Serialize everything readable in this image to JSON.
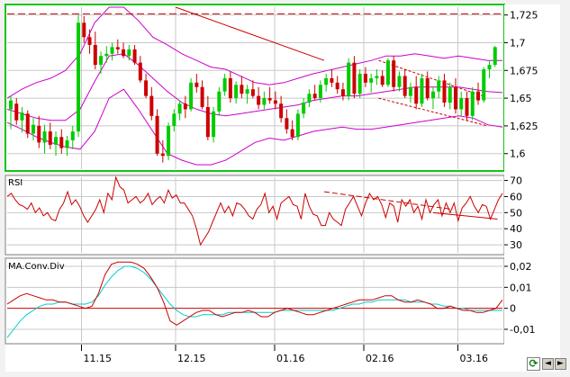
{
  "chart_data": [
    {
      "type": "candlestick",
      "panel": "price",
      "y_ticks": [
        "1,725",
        "1,7",
        "1,675",
        "1,65",
        "1,625",
        "1,6"
      ],
      "ylim": [
        1.586,
        1.732
      ],
      "x_ticks": [
        "11.15",
        "12.15",
        "01.16",
        "02.16",
        "03.16"
      ],
      "candles": [
        [
          1.64,
          1.652,
          1.622,
          1.648
        ],
        [
          1.645,
          1.65,
          1.626,
          1.63
        ],
        [
          1.63,
          1.642,
          1.619,
          1.637
        ],
        [
          1.636,
          1.639,
          1.614,
          1.618
        ],
        [
          1.618,
          1.632,
          1.612,
          1.626
        ],
        [
          1.625,
          1.634,
          1.605,
          1.61
        ],
        [
          1.61,
          1.626,
          1.6,
          1.62
        ],
        [
          1.62,
          1.628,
          1.604,
          1.608
        ],
        [
          1.608,
          1.62,
          1.598,
          1.615
        ],
        [
          1.615,
          1.622,
          1.6,
          1.605
        ],
        [
          1.605,
          1.616,
          1.598,
          1.612
        ],
        [
          1.612,
          1.625,
          1.604,
          1.62
        ],
        [
          1.62,
          1.725,
          1.615,
          1.718
        ],
        [
          1.718,
          1.724,
          1.7,
          1.705
        ],
        [
          1.705,
          1.712,
          1.69,
          1.698
        ],
        [
          1.698,
          1.71,
          1.676,
          1.68
        ],
        [
          1.68,
          1.692,
          1.672,
          1.688
        ],
        [
          1.688,
          1.697,
          1.682,
          1.69
        ],
        [
          1.69,
          1.7,
          1.684,
          1.696
        ],
        [
          1.696,
          1.703,
          1.69,
          1.694
        ],
        [
          1.694,
          1.7,
          1.686,
          1.688
        ],
        [
          1.688,
          1.698,
          1.684,
          1.694
        ],
        [
          1.694,
          1.698,
          1.68,
          1.682
        ],
        [
          1.682,
          1.688,
          1.664,
          1.666
        ],
        [
          1.666,
          1.672,
          1.65,
          1.652
        ],
        [
          1.652,
          1.66,
          1.63,
          1.634
        ],
        [
          1.634,
          1.64,
          1.598,
          1.6
        ],
        [
          1.6,
          1.612,
          1.592,
          1.598
        ],
        [
          1.598,
          1.628,
          1.594,
          1.625
        ],
        [
          1.625,
          1.64,
          1.62,
          1.636
        ],
        [
          1.636,
          1.648,
          1.63,
          1.645
        ],
        [
          1.645,
          1.652,
          1.632,
          1.64
        ],
        [
          1.64,
          1.668,
          1.638,
          1.664
        ],
        [
          1.664,
          1.672,
          1.655,
          1.66
        ],
        [
          1.66,
          1.666,
          1.64,
          1.642
        ],
        [
          1.642,
          1.652,
          1.612,
          1.615
        ],
        [
          1.615,
          1.642,
          1.61,
          1.638
        ],
        [
          1.638,
          1.66,
          1.634,
          1.656
        ],
        [
          1.656,
          1.672,
          1.652,
          1.668
        ],
        [
          1.668,
          1.674,
          1.646,
          1.65
        ],
        [
          1.65,
          1.665,
          1.645,
          1.662
        ],
        [
          1.662,
          1.67,
          1.65,
          1.654
        ],
        [
          1.654,
          1.662,
          1.645,
          1.658
        ],
        [
          1.658,
          1.666,
          1.65,
          1.652
        ],
        [
          1.652,
          1.66,
          1.64,
          1.644
        ],
        [
          1.644,
          1.656,
          1.64,
          1.65
        ],
        [
          1.65,
          1.66,
          1.645,
          1.648
        ],
        [
          1.648,
          1.656,
          1.64,
          1.645
        ],
        [
          1.645,
          1.652,
          1.628,
          1.632
        ],
        [
          1.632,
          1.64,
          1.618,
          1.622
        ],
        [
          1.622,
          1.63,
          1.612,
          1.615
        ],
        [
          1.615,
          1.64,
          1.612,
          1.636
        ],
        [
          1.636,
          1.65,
          1.632,
          1.646
        ],
        [
          1.646,
          1.658,
          1.642,
          1.654
        ],
        [
          1.654,
          1.662,
          1.648,
          1.65
        ],
        [
          1.65,
          1.666,
          1.646,
          1.662
        ],
        [
          1.662,
          1.672,
          1.656,
          1.668
        ],
        [
          1.668,
          1.676,
          1.66,
          1.664
        ],
        [
          1.664,
          1.67,
          1.654,
          1.658
        ],
        [
          1.658,
          1.664,
          1.648,
          1.652
        ],
        [
          1.652,
          1.686,
          1.648,
          1.682
        ],
        [
          1.682,
          1.688,
          1.65,
          1.654
        ],
        [
          1.654,
          1.676,
          1.65,
          1.672
        ],
        [
          1.672,
          1.678,
          1.66,
          1.664
        ],
        [
          1.664,
          1.672,
          1.655,
          1.668
        ],
        [
          1.668,
          1.676,
          1.662,
          1.67
        ],
        [
          1.67,
          1.675,
          1.66,
          1.662
        ],
        [
          1.662,
          1.686,
          1.66,
          1.684
        ],
        [
          1.684,
          1.688,
          1.656,
          1.66
        ],
        [
          1.66,
          1.674,
          1.656,
          1.67
        ],
        [
          1.67,
          1.676,
          1.65,
          1.652
        ],
        [
          1.652,
          1.664,
          1.646,
          1.66
        ],
        [
          1.66,
          1.67,
          1.64,
          1.645
        ],
        [
          1.645,
          1.672,
          1.642,
          1.668
        ],
        [
          1.668,
          1.674,
          1.648,
          1.65
        ],
        [
          1.65,
          1.66,
          1.64,
          1.656
        ],
        [
          1.656,
          1.67,
          1.65,
          1.666
        ],
        [
          1.666,
          1.672,
          1.642,
          1.646
        ],
        [
          1.646,
          1.664,
          1.64,
          1.66
        ],
        [
          1.66,
          1.668,
          1.636,
          1.64
        ],
        [
          1.64,
          1.656,
          1.634,
          1.65
        ],
        [
          1.65,
          1.656,
          1.63,
          1.634
        ],
        [
          1.634,
          1.66,
          1.63,
          1.656
        ],
        [
          1.656,
          1.664,
          1.644,
          1.648
        ],
        [
          1.648,
          1.678,
          1.646,
          1.676
        ],
        [
          1.676,
          1.684,
          1.668,
          1.68
        ],
        [
          1.68,
          1.697,
          1.678,
          1.696
        ]
      ],
      "upper_band": [
        1.65,
        1.658,
        1.664,
        1.668,
        1.675,
        1.69,
        1.718,
        1.732,
        1.732,
        1.72,
        1.705,
        1.698,
        1.69,
        1.684,
        1.678,
        1.676,
        1.67,
        1.664,
        1.662,
        1.664,
        1.668,
        1.672,
        1.675,
        1.678,
        1.681,
        1.684,
        1.688,
        1.688,
        1.69,
        1.688,
        1.686,
        1.688,
        1.686,
        1.684,
        1.684
      ],
      "lower_band": [
        1.628,
        1.622,
        1.615,
        1.61,
        1.606,
        1.604,
        1.62,
        1.65,
        1.658,
        1.64,
        1.62,
        1.6,
        1.594,
        1.59,
        1.59,
        1.594,
        1.602,
        1.61,
        1.614,
        1.612,
        1.616,
        1.62,
        1.622,
        1.624,
        1.622,
        1.622,
        1.624,
        1.626,
        1.628,
        1.63,
        1.632,
        1.634,
        1.632,
        1.626,
        1.624
      ],
      "mid_band": [
        1.64,
        1.636,
        1.632,
        1.63,
        1.63,
        1.64,
        1.665,
        1.688,
        1.69,
        1.68,
        1.668,
        1.656,
        1.646,
        1.64,
        1.636,
        1.634,
        1.636,
        1.638,
        1.64,
        1.642,
        1.644,
        1.648,
        1.65,
        1.652,
        1.652,
        1.654,
        1.656,
        1.658,
        1.66,
        1.66,
        1.66,
        1.66,
        1.658,
        1.656,
        1.655
      ],
      "support_resistance": 1.726,
      "trendline_top": [
        [
          0.34,
          1.732
        ],
        [
          0.64,
          1.684
        ]
      ],
      "channel_upper": [
        [
          0.75,
          1.684
        ],
        [
          0.96,
          1.652
        ]
      ],
      "channel_lower": [
        [
          0.75,
          1.65
        ],
        [
          0.97,
          1.625
        ]
      ],
      "colors": {
        "up": "#00cc00",
        "down": "#cc0000",
        "band": "#cc00cc",
        "trend": "#cc0000",
        "dashed": "#cc0000"
      }
    },
    {
      "type": "line",
      "panel": "rsi",
      "title": "RSI",
      "y_ticks": [
        "70",
        "60",
        "50",
        "40",
        "30"
      ],
      "ylim": [
        25,
        72
      ],
      "values": [
        60,
        62,
        58,
        55,
        54,
        52,
        56,
        50,
        53,
        48,
        50,
        46,
        45,
        52,
        56,
        63,
        55,
        58,
        54,
        48,
        44,
        48,
        52,
        58,
        50,
        62,
        58,
        72,
        66,
        64,
        56,
        58,
        60,
        56,
        58,
        62,
        55,
        58,
        60,
        56,
        64,
        59,
        61,
        56,
        56,
        52,
        48,
        40,
        30,
        34,
        38,
        44,
        50,
        56,
        50,
        54,
        48,
        56,
        55,
        52,
        48,
        46,
        52,
        55,
        62,
        50,
        54,
        46,
        56,
        58,
        60,
        55,
        54,
        46,
        62,
        54,
        49,
        48,
        42,
        42,
        50,
        46,
        44,
        42,
        52,
        56,
        60,
        54,
        48,
        56,
        62,
        58,
        60,
        55,
        47,
        56,
        54,
        44,
        58,
        54,
        58,
        50,
        54,
        46,
        58,
        50,
        55,
        58,
        48,
        56,
        50,
        56,
        45,
        53,
        56,
        60,
        54,
        50,
        55,
        54,
        46,
        52,
        58,
        62
      ],
      "trend_dashed": [
        [
          0.64,
          63
        ],
        [
          0.9,
          52
        ]
      ],
      "trend_dashed2": [
        [
          0.86,
          50
        ],
        [
          0.99,
          46
        ]
      ],
      "color": "#cc0000"
    },
    {
      "type": "line",
      "panel": "macd",
      "title": "MA.Conv.Div",
      "y_ticks": [
        "0,02",
        "0,01",
        "0",
        "-0,01"
      ],
      "ylim": [
        -0.016,
        0.023
      ],
      "macd": [
        0.002,
        0.004,
        0.006,
        0.007,
        0.006,
        0.005,
        0.004,
        0.004,
        0.003,
        0.003,
        0.002,
        0.001,
        0.0,
        0.001,
        0.007,
        0.016,
        0.021,
        0.022,
        0.022,
        0.022,
        0.021,
        0.019,
        0.015,
        0.01,
        0.003,
        -0.006,
        -0.008,
        -0.006,
        -0.004,
        -0.002,
        -0.001,
        -0.001,
        -0.003,
        -0.004,
        -0.003,
        -0.002,
        -0.002,
        -0.001,
        -0.002,
        -0.004,
        -0.004,
        -0.002,
        -0.001,
        0.0,
        -0.001,
        -0.002,
        -0.003,
        -0.003,
        -0.002,
        -0.001,
        0.0,
        0.001,
        0.002,
        0.003,
        0.004,
        0.004,
        0.004,
        0.005,
        0.006,
        0.006,
        0.004,
        0.003,
        0.003,
        0.004,
        0.003,
        0.002,
        0.0,
        0.0,
        0.001,
        0.0,
        -0.001,
        -0.001,
        -0.002,
        -0.002,
        -0.001,
        0.0,
        0.004
      ],
      "signal": [
        -0.014,
        -0.01,
        -0.006,
        -0.003,
        -0.001,
        0.001,
        0.002,
        0.002,
        0.003,
        0.003,
        0.002,
        0.002,
        0.002,
        0.003,
        0.006,
        0.011,
        0.015,
        0.018,
        0.02,
        0.02,
        0.019,
        0.017,
        0.014,
        0.01,
        0.006,
        0.002,
        -0.001,
        -0.003,
        -0.004,
        -0.004,
        -0.003,
        -0.003,
        -0.003,
        -0.003,
        -0.002,
        -0.002,
        -0.002,
        -0.002,
        -0.002,
        -0.002,
        -0.002,
        -0.002,
        -0.001,
        -0.001,
        -0.001,
        -0.001,
        -0.001,
        -0.001,
        -0.001,
        -0.001,
        -0.001,
        0.0,
        0.001,
        0.002,
        0.002,
        0.003,
        0.003,
        0.004,
        0.004,
        0.004,
        0.004,
        0.004,
        0.003,
        0.003,
        0.003,
        0.002,
        0.002,
        0.001,
        0.001,
        0.0,
        0.0,
        -0.001,
        -0.001,
        -0.001,
        -0.001,
        -0.001,
        -0.001
      ],
      "colors": {
        "macd": "#cc0000",
        "signal": "#00cccc",
        "zero": "#cc0000"
      }
    }
  ],
  "ui": {
    "refresh_icon": "refresh-icon",
    "scroll_left_icon": "arrow-left-icon",
    "scroll_right_icon": "arrow-right-icon",
    "left_glyph": "◄",
    "right_glyph": "►",
    "refresh_glyph": "⟳"
  }
}
